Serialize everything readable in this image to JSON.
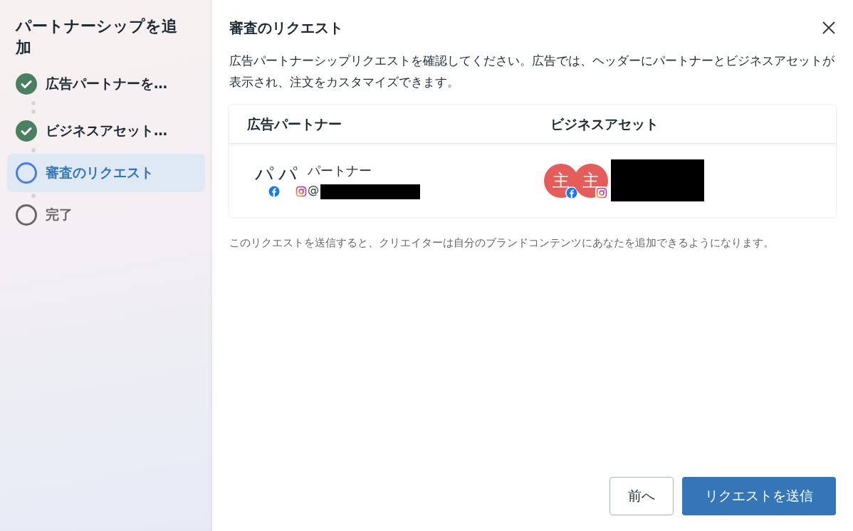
{
  "sidebar": {
    "title": "パートナーシップを追加",
    "steps": [
      {
        "label": "広告パートナーを…",
        "kind": "done",
        "selected": false
      },
      {
        "label": "ビジネスアセット…",
        "kind": "done",
        "selected": false
      },
      {
        "label": "審査のリクエスト",
        "kind": "current",
        "selected": true
      },
      {
        "label": "完了",
        "kind": "todo",
        "selected": false
      }
    ]
  },
  "dialog": {
    "title": "審査のリクエスト",
    "description": "広告パートナーシップリクエストを確認してください。広告では、ヘッダーにパートナーとビジネスアセットが表示され、注文をカスタマイズできます。",
    "table": {
      "columns": [
        "広告パートナー",
        "ビジネスアセット"
      ],
      "partner": {
        "avatar_text": "パパ",
        "name": "パートナー",
        "handle": "@",
        "redacted": true
      },
      "asset": {
        "avatar_text": [
          "主",
          "主"
        ],
        "redacted": true
      }
    },
    "note": "このリクエストを送信すると、クリエイターは自分のブランドコンテンツにあなたを追加できるようになります。",
    "buttons": [
      {
        "label": "前へ",
        "kind": "secondary"
      },
      {
        "label": "リクエストを送信",
        "kind": "primary"
      }
    ]
  }
}
